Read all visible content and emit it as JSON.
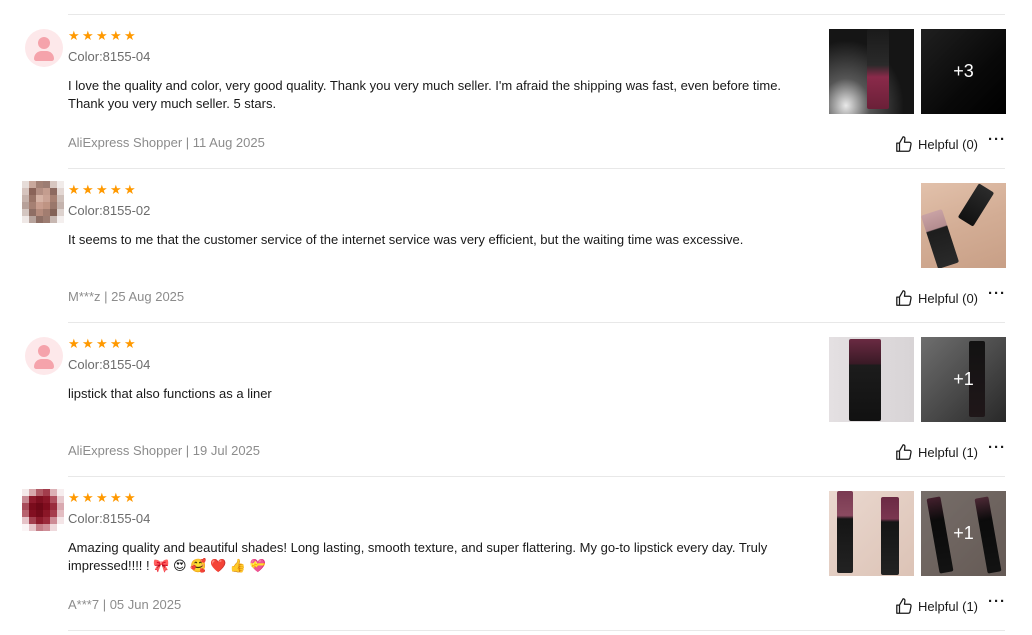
{
  "reviews": [
    {
      "avatar_type": "default",
      "rating": 5,
      "color_label": "Color:8155-04",
      "text": "I love the quality and color, very good quality. Thank you very much seller. I'm afraid the shipping was fast, even before time. Thank you very much seller. 5 stars.",
      "author": "AliExpress Shopper",
      "date": "11 Aug 2025",
      "helpful_label": "Helpful (0)",
      "photos": 2,
      "more_photos": "+3"
    },
    {
      "avatar_type": "pixelated",
      "rating": 5,
      "color_label": "Color:8155-02",
      "text": "It seems to me that the customer service of the internet service was very efficient, but the waiting time was excessive.",
      "author": "M***z",
      "date": "25 Aug 2025",
      "helpful_label": "Helpful (0)",
      "photos": 1,
      "more_photos": ""
    },
    {
      "avatar_type": "default",
      "rating": 5,
      "color_label": "Color:8155-04",
      "text": "lipstick that also functions as a liner",
      "author": "AliExpress Shopper",
      "date": "19 Jul 2025",
      "helpful_label": "Helpful (1)",
      "photos": 2,
      "more_photos": "+1"
    },
    {
      "avatar_type": "pixelated",
      "rating": 5,
      "color_label": "Color:8155-04",
      "text": "Amazing quality and beautiful shades! Long lasting, smooth texture, and super flattering. My go-to lipstick every day. Truly impressed!!!! ! 🎀 😍 🥰 ❤️ 👍 💝",
      "author": "A***7",
      "date": "05 Jun 2025",
      "helpful_label": "Helpful (1)",
      "photos": 2,
      "more_photos": "+1"
    }
  ],
  "separator": " | ",
  "star_char": "★",
  "more_char": "···",
  "colors": {
    "star": "#ff9900",
    "meta_text": "#8c8c8c",
    "divider": "#e8e8e8",
    "avatar_bg": "#fde8ea"
  },
  "icons": [
    "star-icon",
    "thumbs-up-icon",
    "more-options-icon",
    "default-avatar-icon"
  ]
}
